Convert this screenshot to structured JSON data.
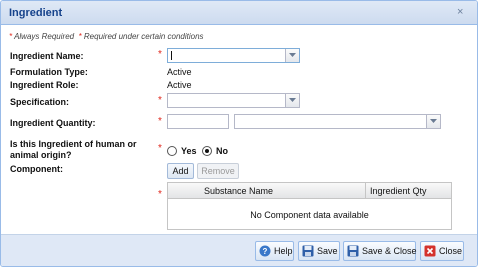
{
  "dialog": {
    "title": "Ingredient",
    "close_glyph": "×"
  },
  "legend": {
    "always_star": "*",
    "always_text": "Always Required",
    "conditional_star": "*",
    "conditional_text": "Required under certain conditions"
  },
  "form": {
    "ingredient_name": {
      "label": "Ingredient Name:",
      "value": ""
    },
    "formulation_type": {
      "label": "Formulation Type:",
      "value": "Active"
    },
    "ingredient_role": {
      "label": "Ingredient Role:",
      "value": "Active"
    },
    "specification": {
      "label": "Specification:",
      "value": ""
    },
    "ingredient_quantity": {
      "label": "Ingredient Quantity:",
      "amount": "",
      "unit": ""
    },
    "origin": {
      "label_line1": "Is this Ingredient of human or",
      "label_line2": "animal origin?",
      "yes_label": "Yes",
      "no_label": "No",
      "selected": "No"
    },
    "component": {
      "label": "Component:",
      "add_label": "Add",
      "remove_label": "Remove"
    },
    "required_star": "*"
  },
  "component_grid": {
    "columns": [
      "Substance Name",
      "Ingredient Qty"
    ],
    "empty_text": "No Component data available",
    "rows": []
  },
  "footer": {
    "help_label": "Help",
    "save_label": "Save",
    "save_close_label": "Save & Close",
    "close_label": "Close"
  },
  "colors": {
    "required": "#e0261c",
    "title_text": "#15428b",
    "header_bg": "#dfe9f6"
  }
}
